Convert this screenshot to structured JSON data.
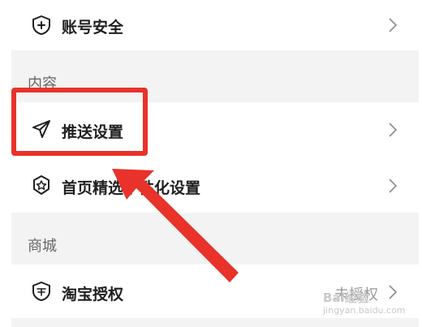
{
  "settings": {
    "account_security": {
      "label": "账号安全",
      "icon": "shield-plus-icon"
    },
    "content_section": {
      "title": "内容"
    },
    "push_settings": {
      "label": "推送设置",
      "icon": "paper-plane-icon"
    },
    "homepage_personalization": {
      "label": "首页精选个性化设置",
      "icon": "star-badge-icon"
    },
    "mall_section": {
      "title": "商城"
    },
    "taobao_auth": {
      "label": "淘宝授权",
      "status": "未授权",
      "icon": "taobao-shield-icon"
    }
  },
  "annotation": {
    "highlight_color": "#e8322a"
  },
  "watermark": {
    "line1": "Bai经验",
    "line2": "jingyan.baidu.com"
  }
}
